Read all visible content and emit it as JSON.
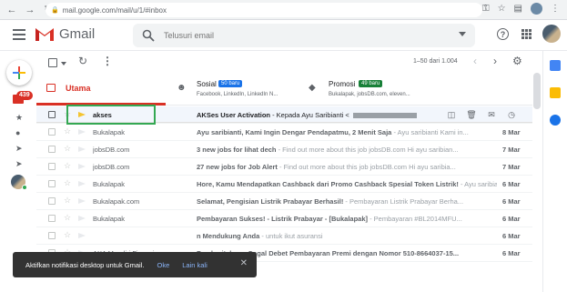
{
  "browser": {
    "url": "mail.google.com/mail/u/1/#inbox"
  },
  "app": {
    "name": "Gmail"
  },
  "search": {
    "placeholder": "Telusuri email"
  },
  "left_rail": {
    "inbox_count": "439"
  },
  "toolbar": {
    "range": "1–50 dari 1.004"
  },
  "tabs": [
    {
      "label": "Utama",
      "active": true
    },
    {
      "label": "Sosial",
      "badge": "50 baru",
      "sub": "Facebook, LinkedIn, LinkedIn N..."
    },
    {
      "label": "Promosi",
      "badge": "49 baru",
      "sub": "Bukalapak, jobsDB.com, eleven..."
    }
  ],
  "emails": [
    {
      "sender": "akses",
      "subject": "AKSes User Activation",
      "snippet": " - Kepada Ayu Saribianti <",
      "date": "",
      "selected": true
    },
    {
      "sender": "Bukalapak",
      "subject": "Ayu saribianti, Kami Ingin Dengar Pendapatmu, 2 Menit Saja",
      "snippet": " - Ayu saribianti Kami in...",
      "date": "8 Mar"
    },
    {
      "sender": "jobsDB.com",
      "subject": "3 new jobs for lihat dech",
      "snippet": " - Find out more about this job jobsDB.com Hi ayu saribian...",
      "date": "7 Mar"
    },
    {
      "sender": "jobsDB.com",
      "subject": "27 new jobs for Job Alert",
      "snippet": " - Find out more about this job jobsDB.com Hi ayu saribia...",
      "date": "7 Mar"
    },
    {
      "sender": "Bukalapak",
      "subject": "Hore, Kamu Mendapatkan Cashback dari Promo Cashback Spesial Token Listrik!",
      "snippet": " - Ayu saribia...",
      "date": "6 Mar"
    },
    {
      "sender": "Bukalapak.com",
      "subject": "Selamat, Pengisian Listrik Prabayar Berhasil!",
      "snippet": " - Pembayaran Listrik Prabayar Berha...",
      "date": "6 Mar"
    },
    {
      "sender": "Bukalapak",
      "subject": "Pembayaran Sukses! - Listrik Prabayar - [Bukalapak]",
      "snippet": " - Pembayaran #BL2014MFU...",
      "date": "6 Mar"
    },
    {
      "sender": "",
      "subject": "n Mendukung Anda",
      "snippet": " - untuk ikut asuransi",
      "date": "6 Mar"
    },
    {
      "sender": "AXA Mandiri Financi.",
      "subject": "Pemberitahuan Gagal Debet Pembayaran Premi dengan Nomor 510-8664037-15...",
      "snippet": "",
      "date": "6 Mar"
    }
  ],
  "snackbar": {
    "message": "Aktifkan notifikasi desktop untuk Gmail.",
    "ok": "Oke",
    "later": "Lain kali"
  },
  "colors": {
    "gmail_red": "#d93025",
    "social_blue": "#1a73e8",
    "promo_green": "#188038",
    "highlight_green": "#34a853"
  }
}
